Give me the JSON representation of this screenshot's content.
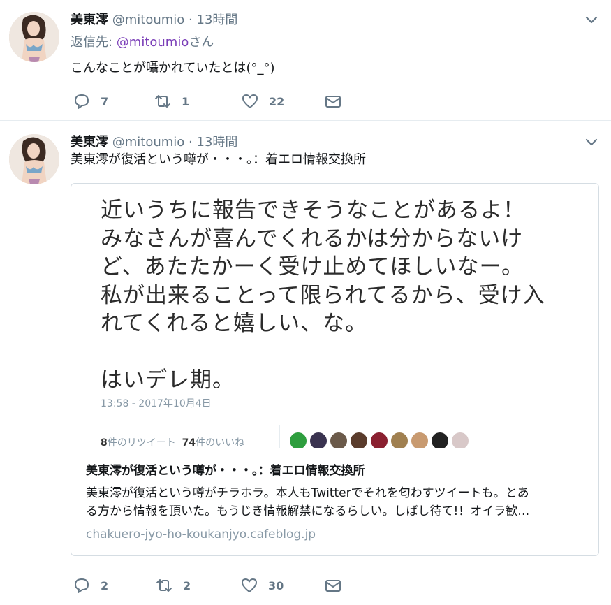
{
  "tweets": [
    {
      "name": "美東澪",
      "handle": "@mitoumio",
      "separator": "·",
      "time": "13時間",
      "reply_prefix": "返信先: ",
      "reply_mention": "@mitoumio",
      "reply_suffix": "さん",
      "text": "こんなことが囁かれていたとは(°_°)",
      "replies": "7",
      "retweets": "1",
      "likes": "22"
    },
    {
      "name": "美東澪",
      "handle": "@mitoumio",
      "separator": "·",
      "time": "13時間",
      "text": "美東澪が復活という噂が・・・。：着エロ情報交換所",
      "card": {
        "image_lines": [
          "近いうちに報告できそうなことがあるよ！",
          "みなさんが喜んでくれるかは分からないけ",
          "ど、あたたかーく受け止めてほしいなー。",
          "私が出来ることって限られてるから、受け入",
          "れてくれると嬉しい、な。",
          "",
          "はいデレ期。"
        ],
        "image_date": "13:58 - 2017年10月4日",
        "image_rt_count": "8",
        "image_rt_label": "件のリツイート",
        "image_like_count": "74",
        "image_like_label": "件のいいね",
        "title": "美東澪が復活という噂が・・・。：着エロ情報交換所",
        "description_line1": "美東澪が復活という噂がチラホラ。本人もTwitterでそれを匂わすツイートも。とあ",
        "description_line2": "る方から情報を頂いた。もうじき情報解禁になるらしい。しばし待て!！オイラ歓…",
        "url": "chakuero-jyo-ho-koukanjyo.cafeblog.jp"
      },
      "replies": "2",
      "retweets": "2",
      "likes": "30"
    }
  ],
  "liker_colors": [
    "#2e9e3e",
    "#3a3350",
    "#6b5a4a",
    "#5a3c2c",
    "#8a2030",
    "#a08050",
    "#c89a70",
    "#222222",
    "#d8c8c8"
  ],
  "icons": {
    "reply": "reply-icon",
    "retweet": "retweet-icon",
    "like": "heart-icon",
    "dm": "envelope-icon",
    "caret": "chevron-down-icon"
  }
}
